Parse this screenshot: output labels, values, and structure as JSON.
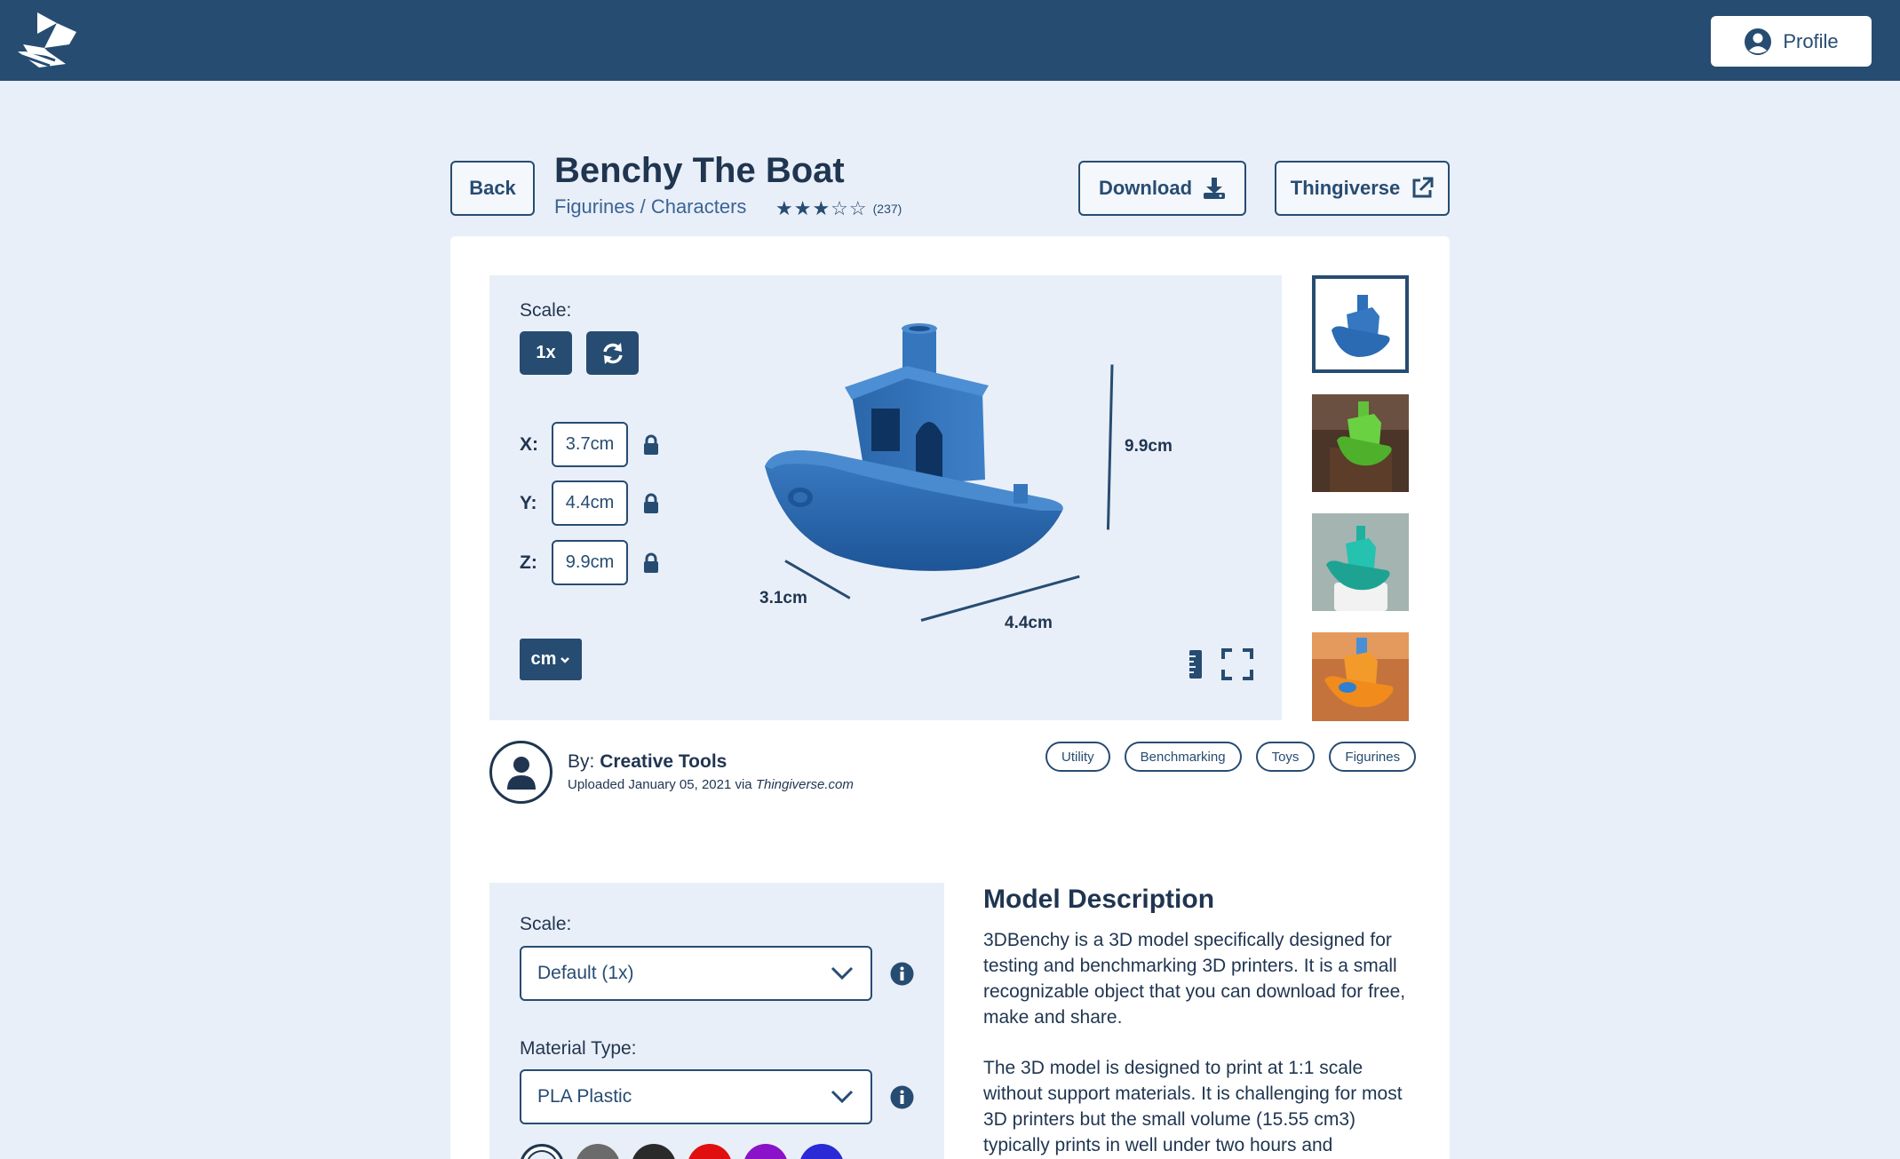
{
  "header": {
    "logo_icon": "app-logo-icon",
    "profile_label": "Profile",
    "profile_icon": "user-circle-icon"
  },
  "model": {
    "back_label": "Back",
    "title": "Benchy The Boat",
    "breadcrumb": "Figurines / Characters",
    "rating_stars": "★★★☆☆",
    "rating_value": 3,
    "rating_count": "(237)",
    "download_label": "Download",
    "thingiverse_label": "Thingiverse"
  },
  "viewer": {
    "scale_label": "Scale:",
    "scale_button": "1x",
    "dims": [
      {
        "label": "X:",
        "value": "3.7cm"
      },
      {
        "label": "Y:",
        "value": "4.4cm"
      },
      {
        "label": "Z:",
        "value": "9.9cm"
      }
    ],
    "unit": "cm",
    "height_label": "9.9cm",
    "depth_label": "3.1cm",
    "width_label": "4.4cm"
  },
  "thumbnails": [
    {
      "name": "blue-benchy",
      "selected": true
    },
    {
      "name": "green-benchy",
      "selected": false
    },
    {
      "name": "teal-benchy",
      "selected": false
    },
    {
      "name": "orange-benchy",
      "selected": false
    }
  ],
  "author": {
    "by_prefix": "By:",
    "name": "Creative Tools",
    "uploaded_prefix": "Uploaded January 05, 2021 via",
    "source": "Thingiverse.com"
  },
  "tags": [
    "Utility",
    "Benchmarking",
    "Toys",
    "Figurines"
  ],
  "order": {
    "scale_label": "Scale:",
    "scale_value": "Default (1x)",
    "material_label": "Material Type:",
    "material_value": "PLA Plastic",
    "swatch_colors": [
      "#ffffff",
      "#6b6b6b",
      "#2a2a2a",
      "#e01010",
      "#8a12c8",
      "#2a2ad6"
    ]
  },
  "description": {
    "title": "Model Description",
    "p1": "3DBenchy is a 3D model specifically designed for testing and benchmarking 3D printers. It is a small recognizable object that you can download for free, make and share.",
    "p2": "The 3D model is designed to print at 1:1 scale without support materials. It is challenging for most 3D printers but the small volume (15.55 cm3) typically prints in well under two hours and"
  },
  "colors": {
    "primary": "#274c72",
    "background": "#e9eff8",
    "text": "#1f3550"
  }
}
